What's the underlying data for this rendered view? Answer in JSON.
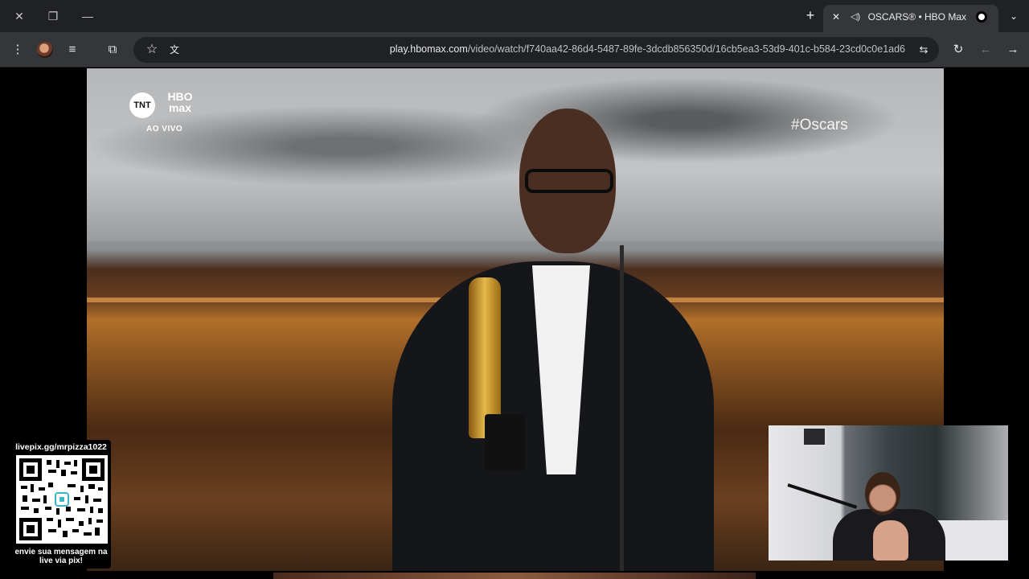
{
  "browser": {
    "tab": {
      "title": "OSCARS® • HBO Max"
    },
    "new_tab_label": "+",
    "window_controls": [
      "close-icon",
      "restore-icon",
      "minimize-icon"
    ],
    "omnibox": {
      "host": "play.hbomax.com",
      "path": "/video/watch/f740aa42-86d4-5487-89fe-3dcdb856350d/16cb5ea3-53d9-401c-b584-23cd0c0e1ad6"
    }
  },
  "video": {
    "brand_network": "TNT",
    "brand_service": "HBO max",
    "live_label": "AO VIVO",
    "hashtag": "#Oscars"
  },
  "overlay": {
    "qr_link": "livepix.gg/mrpizza1022",
    "qr_message": "envie sua mensagem na live via pix!"
  },
  "colors": {
    "tabbar_bg": "#202124",
    "toolbar_bg": "#35363a",
    "omnibox_bg": "#202124"
  }
}
